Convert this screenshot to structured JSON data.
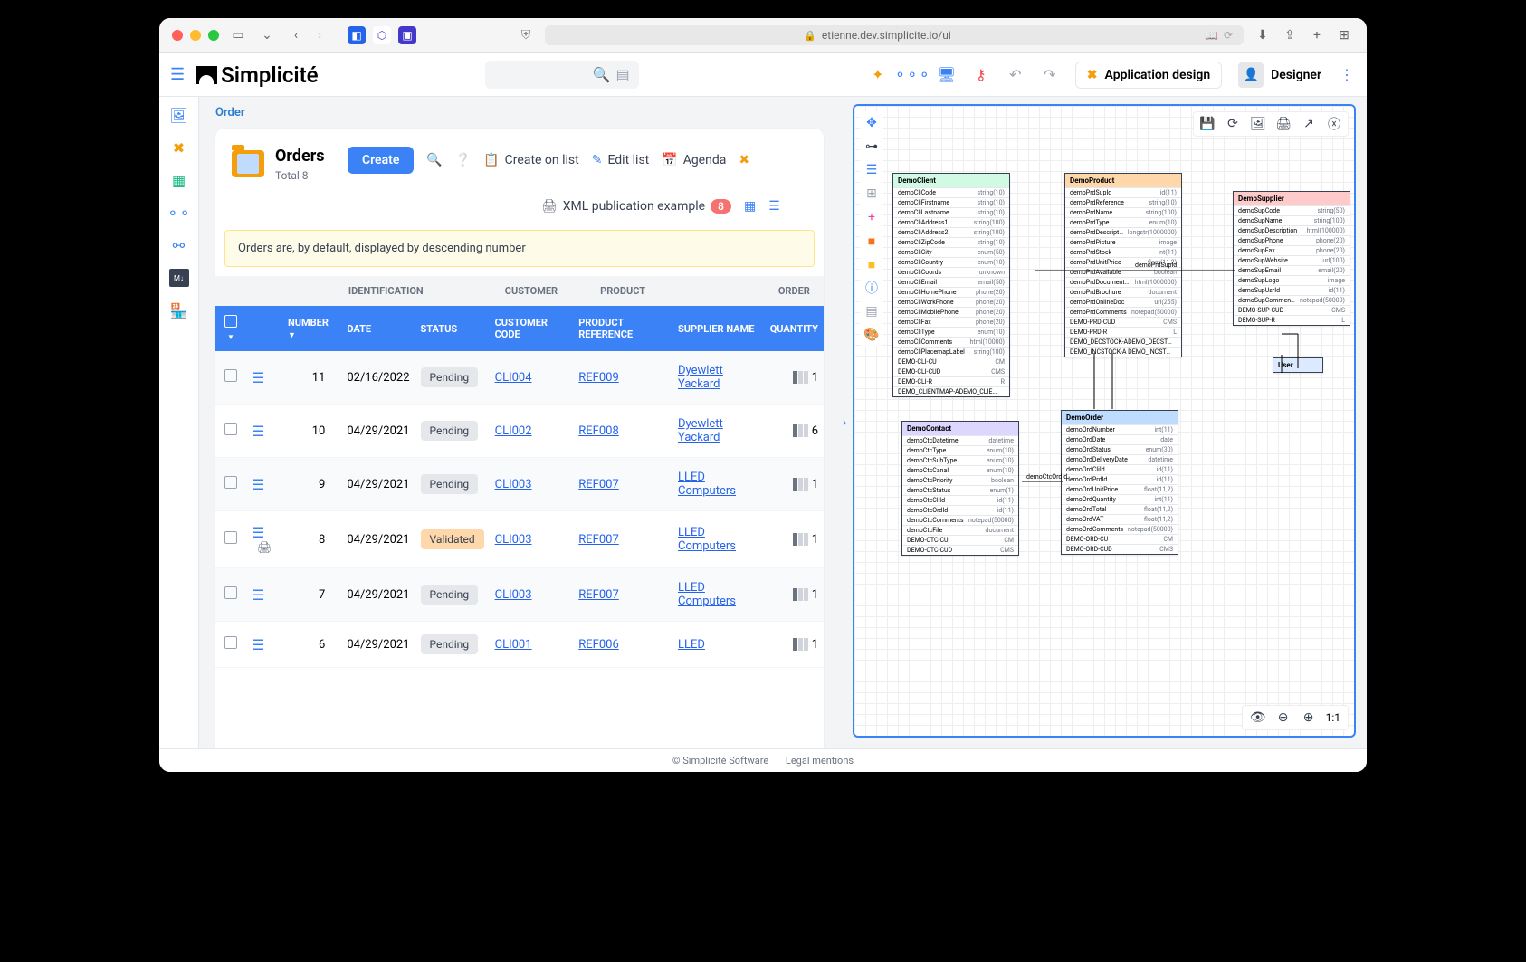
{
  "browser": {
    "url": "etienne.dev.simplicite.io/ui"
  },
  "header": {
    "logo": "Simplicité",
    "app_design": "Application design",
    "user": "Designer"
  },
  "breadcrumb": "Order",
  "orders": {
    "title": "Orders",
    "total_label": "Total 8",
    "create": "Create",
    "create_on_list": "Create on list",
    "edit_list": "Edit list",
    "agenda": "Agenda",
    "xml_pub": "XML publication example",
    "xml_count": "8",
    "notice": "Orders are, by default, displayed by descending number"
  },
  "table": {
    "group_identification": "IDENTIFICATION",
    "group_customer": "CUSTOMER",
    "group_product": "PRODUCT",
    "group_order": "ORDER",
    "col_number": "NUMBER",
    "col_date": "DATE",
    "col_status": "STATUS",
    "col_customer_code": "CUSTOMER CODE",
    "col_product_ref": "PRODUCT REFERENCE",
    "col_supplier_name": "SUPPLIER NAME",
    "col_quantity": "QUANTITY",
    "rows": [
      {
        "number": "11",
        "date": "02/16/2022",
        "status": "Pending",
        "customer": "CLI004",
        "product": "REF009",
        "supplier": "Dyewlett Yackard",
        "qty": "1"
      },
      {
        "number": "10",
        "date": "04/29/2021",
        "status": "Pending",
        "customer": "CLI002",
        "product": "REF008",
        "supplier": "Dyewlett Yackard",
        "qty": "6"
      },
      {
        "number": "9",
        "date": "04/29/2021",
        "status": "Pending",
        "customer": "CLI003",
        "product": "REF007",
        "supplier": "LLED Computers",
        "qty": "1"
      },
      {
        "number": "8",
        "date": "04/29/2021",
        "status": "Validated",
        "customer": "CLI003",
        "product": "REF007",
        "supplier": "LLED Computers",
        "qty": "1"
      },
      {
        "number": "7",
        "date": "04/29/2021",
        "status": "Pending",
        "customer": "CLI003",
        "product": "REF007",
        "supplier": "LLED Computers",
        "qty": "1"
      },
      {
        "number": "6",
        "date": "04/29/2021",
        "status": "Pending",
        "customer": "CLI001",
        "product": "REF006",
        "supplier": "LLED",
        "qty": "1"
      }
    ]
  },
  "diagram": {
    "zoom": "1:1",
    "entities": {
      "DemoClient": [
        [
          "demoCliCode",
          "string(10)"
        ],
        [
          "demoCliFirstname",
          "string(10)"
        ],
        [
          "demoCliLastname",
          "string(10)"
        ],
        [
          "demoCliAddress1",
          "string(100)"
        ],
        [
          "demoCliAddress2",
          "string(100)"
        ],
        [
          "demoCliZipCode",
          "string(10)"
        ],
        [
          "demoCliCity",
          "enum(50)"
        ],
        [
          "demoCliCountry",
          "enum(10)"
        ],
        [
          "demoCliCoords",
          "unknown"
        ],
        [
          "demoCliEmail",
          "email(50)"
        ],
        [
          "demoCliHomePhone",
          "phone(20)"
        ],
        [
          "demoCliWorkPhone",
          "phone(20)"
        ],
        [
          "demoCliMobilePhone",
          "phone(20)"
        ],
        [
          "demoCliFax",
          "phone(20)"
        ],
        [
          "demoCliType",
          "enum(10)"
        ],
        [
          "demoCliComments",
          "html(10000)"
        ],
        [
          "demoCliPlacemapLabel",
          "string(100)"
        ],
        [
          "DEMO-CLI-CU",
          "CM"
        ],
        [
          "DEMO-CLI-CUD",
          "CMS"
        ],
        [
          "DEMO-CLI-R",
          "R"
        ],
        [
          "DEMO_CLIENTMAP-ADEMO_CLIENTMAP",
          ""
        ]
      ],
      "DemoProduct": [
        [
          "demoPrdSupId",
          "id(11)"
        ],
        [
          "demoPrdReference",
          "string(10)"
        ],
        [
          "demoPrdName",
          "string(100)"
        ],
        [
          "demoPrdType",
          "enum(10)"
        ],
        [
          "demoPrdDescription",
          "longstr(1000000)"
        ],
        [
          "demoPrdPicture",
          "image"
        ],
        [
          "demoPrdStock",
          "int(11)"
        ],
        [
          "demoPrdUnitPrice",
          "float(11,2)"
        ],
        [
          "demoPrdAvailable",
          "boolean"
        ],
        [
          "demoPrdDocumentation",
          "html(1000000)"
        ],
        [
          "demoPrdBrochure",
          "document"
        ],
        [
          "demoPrdOnlineDoc",
          "url(255)"
        ],
        [
          "demoPrdComments",
          "notepad(50000)"
        ],
        [
          "DEMO-PRD-CUD",
          "CMS"
        ],
        [
          "DEMO-PRD-R",
          "L"
        ],
        [
          "DEMO_DECSTOCK-ADEMO_DECSTOCK",
          ""
        ],
        [
          "DEMO_INCSTOCK-A DEMO_INCSTOCK",
          ""
        ]
      ],
      "DemoSupplier": [
        [
          "demoSupCode",
          "string(50)"
        ],
        [
          "demoSupName",
          "string(100)"
        ],
        [
          "demoSupDescription",
          "html(100000)"
        ],
        [
          "demoSupPhone",
          "phone(20)"
        ],
        [
          "demoSupFax",
          "phone(20)"
        ],
        [
          "demoSupWebsite",
          "url(100)"
        ],
        [
          "demoSupEmail",
          "email(20)"
        ],
        [
          "demoSupLogo",
          "image"
        ],
        [
          "demoSupUsrId",
          "id(11)"
        ],
        [
          "demoSupComments",
          "notepad(50000)"
        ],
        [
          "DEMO-SUP-CUD",
          "CMS"
        ],
        [
          "DEMO-SUP-R",
          "L"
        ]
      ],
      "DemoContact": [
        [
          "demoCtcDatetime",
          "datetime"
        ],
        [
          "demoCtcType",
          "enum(10)"
        ],
        [
          "demoCtcSubType",
          "enum(10)"
        ],
        [
          "demoCtcCanal",
          "enum(10)"
        ],
        [
          "demoCtcPriority",
          "boolean"
        ],
        [
          "demoCtcStatus",
          "enum(1)"
        ],
        [
          "demoCtcCliId",
          "id(11)"
        ],
        [
          "demoCtcOrdId",
          "id(11)"
        ],
        [
          "demoCtcComments",
          "notepad(50000)"
        ],
        [
          "demoCtcFile",
          "document"
        ],
        [
          "DEMO-CTC-CU",
          "CM"
        ],
        [
          "DEMO-CTC-CUD",
          "CMS"
        ]
      ],
      "DemoOrder": [
        [
          "demoOrdNumber",
          "int(11)"
        ],
        [
          "demoOrdDate",
          "date"
        ],
        [
          "demoOrdStatus",
          "enum(30)"
        ],
        [
          "demoOrdDeliveryDate",
          "datetime"
        ],
        [
          "demoOrdCliId",
          "id(11)"
        ],
        [
          "demoOrdPrdId",
          "id(11)"
        ],
        [
          "demoOrdUnitPrice",
          "float(11,2)"
        ],
        [
          "demoOrdQuantity",
          "int(11)"
        ],
        [
          "demoOrdTotal",
          "float(11,2)"
        ],
        [
          "demoOrdVAT",
          "float(11,2)"
        ],
        [
          "demoOrdComments",
          "notepad(50000)"
        ],
        [
          "DEMO-ORD-CU",
          "CM"
        ],
        [
          "DEMO-ORD-CUD",
          "CMS"
        ]
      ],
      "User": []
    },
    "connectors": [
      {
        "label": "demoPrdSupId",
        "from": "DemoProduct",
        "to": "DemoSupplier"
      },
      {
        "label": "demoCtcOrdId",
        "from": "DemoContact",
        "to": "DemoOrder"
      }
    ]
  },
  "footer": {
    "copyright": "© Simplicité Software",
    "legal": "Legal mentions"
  }
}
